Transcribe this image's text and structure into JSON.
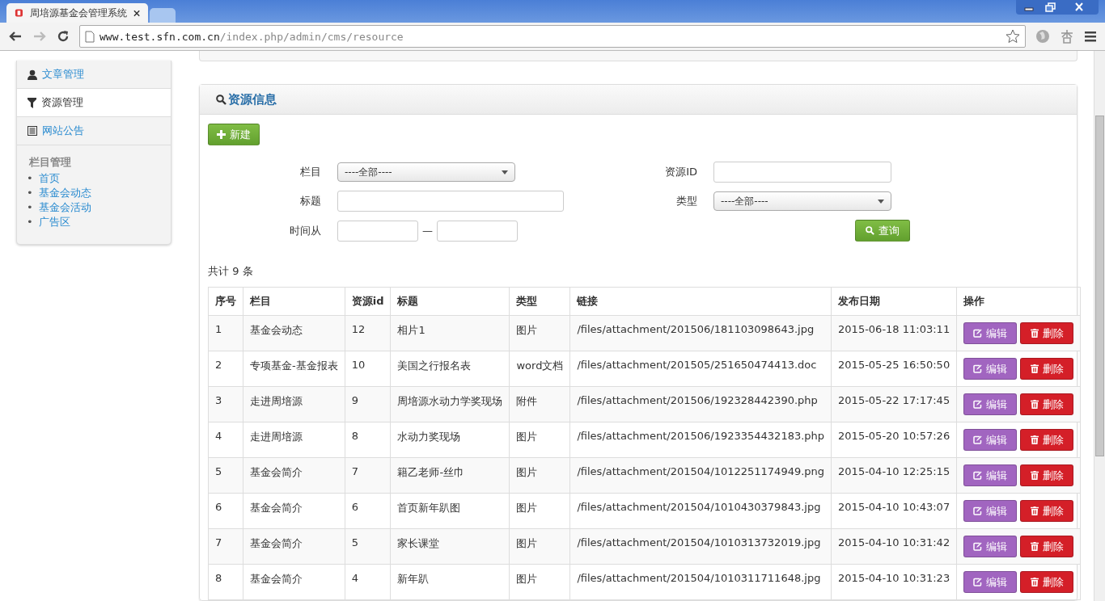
{
  "browser": {
    "tabs": [
      {
        "kind": "page",
        "title": "周培源基金会管理系统",
        "selected": true
      },
      {
        "kind": "new",
        "selected": false
      }
    ],
    "url_host": "www.test.sfn.com.cn",
    "url_path": "/index.php/admin/cms/resource"
  },
  "sidebar": {
    "items": [
      {
        "label": "文章管理",
        "selected": false
      },
      {
        "label": "资源管理",
        "selected": true
      },
      {
        "label": "网站公告",
        "selected": false
      }
    ],
    "section_title": "栏目管理",
    "links": [
      {
        "bullet": "•",
        "label": "首页"
      },
      {
        "bullet": "•",
        "label": "基金会动态"
      },
      {
        "bullet": "•",
        "label": "基金会活动"
      },
      {
        "bullet": "•",
        "label": "广告区"
      }
    ]
  },
  "panel": {
    "title": "资源信息",
    "new_button": "新建",
    "form": {
      "column_label": "栏目",
      "column_value": "----全部----",
      "id_label": "资源ID",
      "title_label": "标题",
      "type_label": "类型",
      "type_value": "----全部----",
      "time_label": "时间从",
      "separator": "—",
      "query_button": "查询"
    },
    "count": "共计 9 条",
    "table": {
      "columns": [
        "序号",
        "栏目",
        "资源id",
        "标题",
        "类型",
        "链接",
        "发布日期",
        "操作"
      ],
      "rows": [
        {
          "cells": [
            "1",
            "基金会动态",
            "12",
            "相片1",
            "图片",
            "/files/attachment/201506/181103098643.jpg",
            "2015-06-18 11:03:11"
          ],
          "edit": "编辑",
          "delete": "删除"
        },
        {
          "cells": [
            "2",
            "专项基金-基金报表",
            "10",
            "美国之行报名表",
            "word文档",
            "/files/attachment/201505/251650474413.doc",
            "2015-05-25 16:50:50"
          ],
          "edit": "编辑",
          "delete": "删除"
        },
        {
          "cells": [
            "3",
            "走进周培源",
            "9",
            "周培源水动力学奖现场",
            "附件",
            "/files/attachment/201506/192328442390.php",
            "2015-05-22 17:17:45"
          ],
          "edit": "编辑",
          "delete": "删除"
        },
        {
          "cells": [
            "4",
            "走进周培源",
            "8",
            "水动力奖现场",
            "图片",
            "/files/attachment/201506/1923354432183.php",
            "2015-05-20 10:57:26"
          ],
          "edit": "编辑",
          "delete": "删除"
        },
        {
          "cells": [
            "5",
            "基金会简介",
            "7",
            "籍乙老师-丝巾",
            "图片",
            "/files/attachment/201504/1012251174949.png",
            "2015-04-10 12:25:15"
          ],
          "edit": "编辑",
          "delete": "删除"
        },
        {
          "cells": [
            "6",
            "基金会简介",
            "6",
            "首页新年趴图",
            "图片",
            "/files/attachment/201504/1010430379843.jpg",
            "2015-04-10 10:43:07"
          ],
          "edit": "编辑",
          "delete": "删除"
        },
        {
          "cells": [
            "7",
            "基金会简介",
            "5",
            "家长课堂",
            "图片",
            "/files/attachment/201504/1010313732019.jpg",
            "2015-04-10 10:31:42"
          ],
          "edit": "编辑",
          "delete": "删除"
        },
        {
          "cells": [
            "8",
            "基金会简介",
            "4",
            "新年趴",
            "图片",
            "/files/attachment/201504/1010311711648.jpg",
            "2015-04-10 10:31:23"
          ],
          "edit": "编辑",
          "delete": "删除"
        }
      ]
    }
  }
}
